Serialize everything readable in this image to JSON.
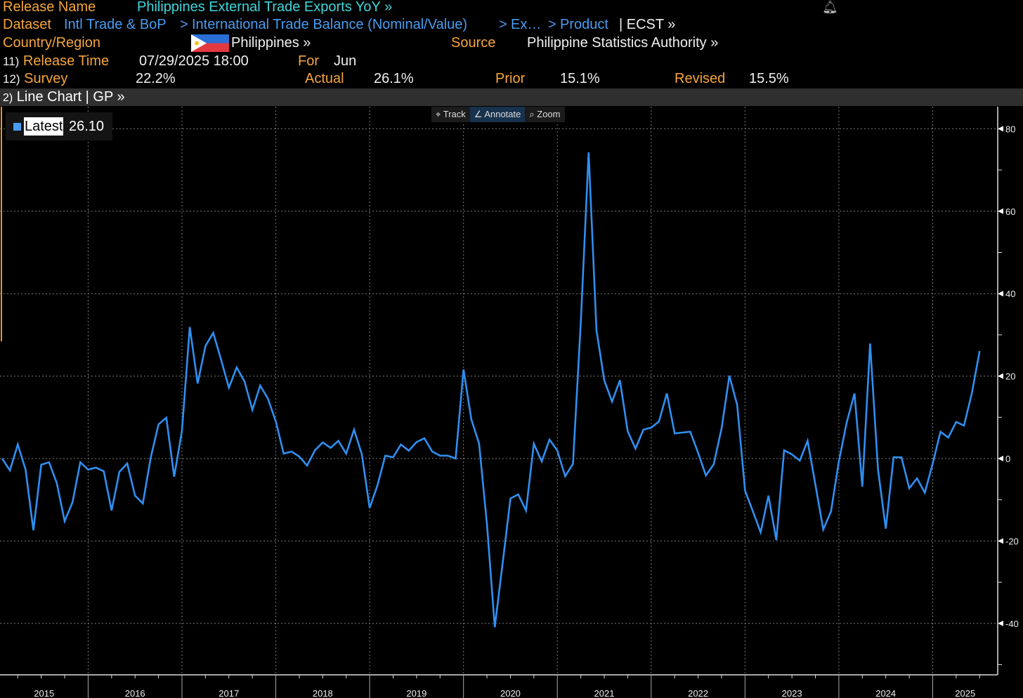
{
  "header": {
    "release_name_label": "Release Name",
    "release_name": "Philippines External Trade Exports YoY »",
    "dataset_label": "Dataset",
    "dataset_path": [
      "Intl Trade & BoP",
      "International Trade Balance (Nominal/Value)",
      "Ex…",
      "Product"
    ],
    "sep": ">",
    "ticker": "| ECST »",
    "country_label": "Country/Region",
    "country": "Philippines »",
    "source_label": "Source",
    "source": "Philippine Statistics Authority »",
    "release_time_num": "11)",
    "release_time_label": "Release Time",
    "release_time": "07/29/2025 18:00",
    "for_label": "For",
    "for_value": "Jun",
    "survey_num": "12)",
    "survey_label": "Survey",
    "survey": "22.2%",
    "actual_label": "Actual",
    "actual": "26.1%",
    "prior_label": "Prior",
    "prior": "15.1%",
    "revised_label": "Revised",
    "revised": "15.5%"
  },
  "chart_bar": {
    "num": "2)",
    "label": "Line Chart | GP »"
  },
  "toolbar": {
    "track": "Track",
    "annotate": "Annotate",
    "zoom": "Zoom"
  },
  "legend": {
    "label": "Latest",
    "value": "26.10"
  },
  "colors": {
    "line": "#2f8ff0",
    "label": "#f5a53a",
    "title": "#3fd6dc",
    "link": "#4a9cf0"
  },
  "chart_data": {
    "type": "line",
    "title": "Philippines External Trade Exports YoY",
    "series": [
      {
        "name": "Latest",
        "start": "2015-01",
        "frequency": "monthly",
        "values": [
          0,
          -2.9,
          3.4,
          -2.7,
          -17.4,
          -1.5,
          -0.9,
          -6,
          -15.2,
          -10.6,
          -0.9,
          -2.7,
          -2.2,
          -3.1,
          -12.6,
          -3.2,
          -1.2,
          -9,
          -10.9,
          0.2,
          8.3,
          9.9,
          -4.4,
          6.8,
          31.9,
          18.2,
          27.3,
          30.5,
          24,
          17.2,
          22.1,
          18.7,
          11.8,
          17.7,
          14.5,
          9,
          1.2,
          1.7,
          0.5,
          -1.7,
          2,
          3.9,
          2.6,
          4.3,
          1.2,
          7,
          1,
          -12,
          -6.5,
          0.7,
          0.3,
          3.4,
          1.9,
          4,
          4.9,
          1.7,
          0.7,
          0.7,
          0,
          21.6,
          9.5,
          3.6,
          -16,
          -40.9,
          -25.5,
          -9.7,
          -8.7,
          -12.6,
          3.6,
          -0.7,
          4.6,
          1.9,
          -4.3,
          -1.3,
          33,
          74.3,
          31.2,
          19,
          13.8,
          19,
          6.6,
          2.4,
          7,
          7.5,
          9,
          15.8,
          6.1,
          6.3,
          6.5,
          1.4,
          -4.1,
          -1.4,
          7.3,
          20.1,
          13,
          -7.8,
          -12.8,
          -17.9,
          -9,
          -19.8,
          2,
          1,
          -0.5,
          4.3,
          -6.3,
          -17.2,
          -12.8,
          -0.7,
          8.7,
          15.8,
          -6.8,
          27.9,
          -2.6,
          -17,
          0.3,
          0.3,
          -7.2,
          -4.8,
          -8.3,
          -1.2,
          6.5,
          5.1,
          8.9,
          8,
          15.8,
          26.1
        ]
      }
    ],
    "x_tick_labels": [
      "2015",
      "2016",
      "2017",
      "2018",
      "2019",
      "2020",
      "2021",
      "2022",
      "2023",
      "2024",
      "2025"
    ],
    "y_tick_labels": [
      "80",
      "60",
      "40",
      "20",
      "0",
      "-20",
      "-40"
    ],
    "y_ticks": [
      80,
      60,
      40,
      20,
      0,
      -20,
      -40
    ],
    "ylim": [
      -51,
      80
    ],
    "xlabel": "",
    "ylabel": "",
    "grid": true,
    "legend": "top-left"
  }
}
